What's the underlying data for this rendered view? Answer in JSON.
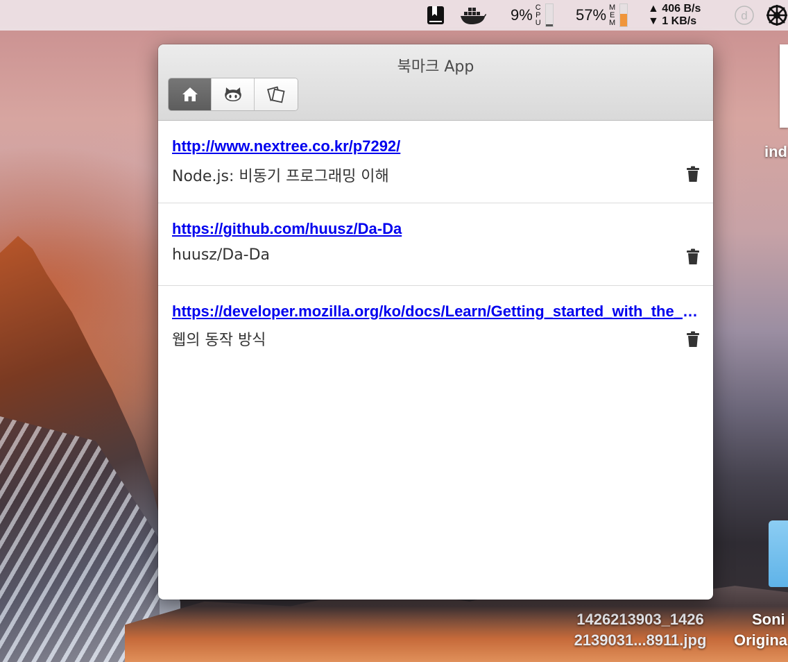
{
  "menubar": {
    "cpu_percent": "9%",
    "cpu_label": [
      "C",
      "P",
      "U"
    ],
    "cpu_fill_fraction": 0.09,
    "mem_percent": "57%",
    "mem_label": [
      "M",
      "E",
      "M"
    ],
    "mem_fill_fraction": 0.57,
    "net_up": "406 B/s",
    "net_down": "1 KB/s",
    "colors": {
      "mem_fill": "#f0953a",
      "cpu_fill": "#555555"
    }
  },
  "desktop": {
    "top_right_label": "ind",
    "file_label_line1": "1426213903_1426",
    "file_label_line2": "2139031...8911.jpg",
    "folder_label_line1": "Soni",
    "folder_label_line2": "Origina"
  },
  "window": {
    "title": "북마크 App",
    "tabs": [
      {
        "icon": "home-icon",
        "active": true
      },
      {
        "icon": "github-octocat-icon",
        "active": false
      },
      {
        "icon": "cards-icon",
        "active": false
      }
    ]
  },
  "bookmarks": [
    {
      "url": "http://www.nextree.co.kr/p7292/",
      "title": "Node.js: 비동기 프로그래밍 이해"
    },
    {
      "url": "https://github.com/huusz/Da-Da",
      "title": "huusz/Da-Da"
    },
    {
      "url": "https://developer.mozilla.org/ko/docs/Learn/Getting_started_with_the_web/How_the_Web_works",
      "title": "웹의 동작 방식"
    }
  ]
}
